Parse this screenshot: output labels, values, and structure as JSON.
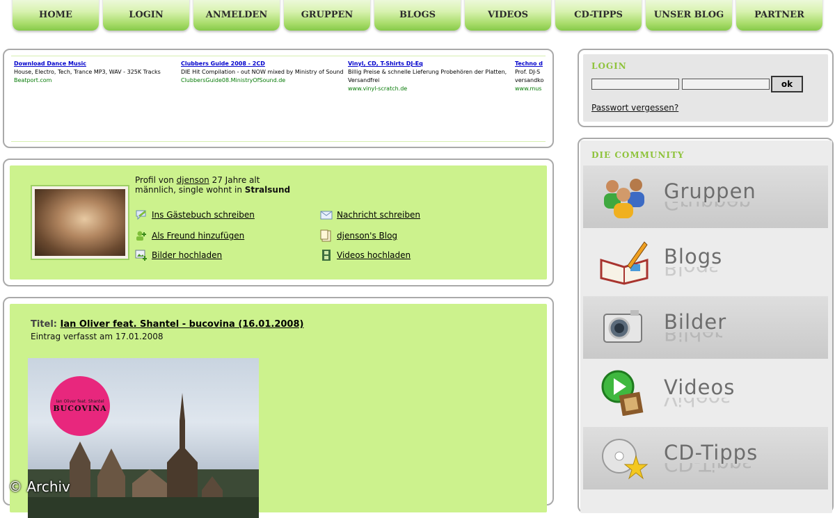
{
  "nav": [
    "HOME",
    "LOGIN",
    "ANMELDEN",
    "GRUPPEN",
    "BLOGS",
    "VIDEOS",
    "CD-TIPPS",
    "UNSER BLOG",
    "PARTNER"
  ],
  "ads": [
    {
      "title": "Download Dance Music",
      "text": "House, Electro, Tech, Trance MP3, WAV - 325K Tracks",
      "url": "Beatport.com"
    },
    {
      "title": "Clubbers Guide 2008 - 2CD",
      "text": "DIE Hit Compilation - out NOW mixed by Ministry of Sound",
      "url": "ClubbersGuide08.MinistryOfSound.de"
    },
    {
      "title": "Vinyl, CD, T-Shirts DJ-Eq",
      "text": "Billig Preise & schnelle Lieferung Probehören der Platten, Versandfrei",
      "url": "www.vinyl-scratch.de"
    },
    {
      "title": "Techno d",
      "text": "Prof. DJ-S versandko",
      "url": "www.mus"
    }
  ],
  "profile": {
    "line1_prefix": "Profil von",
    "username": "djenson",
    "line1_suffix": "27 Jahre alt",
    "line2_prefix": "männlich, single wohnt in",
    "city": "Stralsund",
    "links": {
      "guestbook": "Ins Gästebuch schreiben",
      "message": "Nachricht schreiben",
      "friend": "Als Freund hinzufügen",
      "blog": "djenson's Blog",
      "upload_images": "Bilder hochladen",
      "upload_videos": "Videos hochladen"
    }
  },
  "entry": {
    "title_label": "Titel:",
    "title": "Ian Oliver feat. Shantel - bucovina (16.01.2008)",
    "date": "Eintrag verfasst am 17.01.2008",
    "cover_seal_title": "BUCOVINA"
  },
  "login": {
    "title": "LOGIN",
    "ok": "ok",
    "forgot": "Passwort vergessen?"
  },
  "community": {
    "title": "DIE COMMUNITY",
    "items": [
      "Gruppen",
      "Blogs",
      "Bilder",
      "Videos",
      "CD-Tipps"
    ]
  },
  "watermark": "© Archiv",
  "colors": {
    "accent_green": "#ccf28d",
    "title_green": "#8fc33c",
    "ad_link": "#0000cc",
    "ad_url": "#067a06"
  }
}
